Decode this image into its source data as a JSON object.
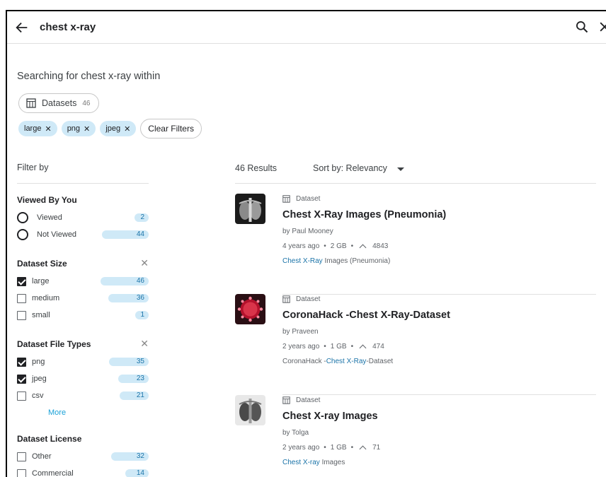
{
  "search": {
    "query": "chest x-ray"
  },
  "scope": {
    "prefix": "Searching for chest x-ray within"
  },
  "datasets_chip": {
    "label": "Datasets",
    "count": "46"
  },
  "active_filters": [
    "large",
    "png",
    "jpeg"
  ],
  "clear_filters_label": "Clear Filters",
  "sidebar": {
    "filter_by_label": "Filter by",
    "viewed": {
      "title": "Viewed By You",
      "items": [
        {
          "label": "Viewed",
          "count": "2",
          "fill": 0.045
        },
        {
          "label": "Not Viewed",
          "count": "44",
          "fill": 0.96
        }
      ]
    },
    "size": {
      "title": "Dataset Size",
      "items": [
        {
          "label": "large",
          "count": "46",
          "checked": true,
          "fill": 1.0
        },
        {
          "label": "medium",
          "count": "36",
          "checked": false,
          "fill": 0.78
        },
        {
          "label": "small",
          "count": "1",
          "checked": false,
          "fill": 0.02
        }
      ]
    },
    "file_types": {
      "title": "Dataset File Types",
      "items": [
        {
          "label": "png",
          "count": "35",
          "checked": true,
          "fill": 0.76
        },
        {
          "label": "jpeg",
          "count": "23",
          "checked": true,
          "fill": 0.5
        },
        {
          "label": "csv",
          "count": "21",
          "checked": false,
          "fill": 0.46
        }
      ],
      "more_label": "More"
    },
    "license": {
      "title": "Dataset License",
      "items": [
        {
          "label": "Other",
          "count": "32",
          "checked": false,
          "fill": 0.7
        },
        {
          "label": "Commercial",
          "count": "14",
          "checked": false,
          "fill": 0.3
        }
      ]
    }
  },
  "results": {
    "count_label": "46 Results",
    "sort_label": "Sort by: Relevancy",
    "items": [
      {
        "type": "Dataset",
        "title": "Chest X-Ray Images (Pneumonia)",
        "by": "by Paul Mooney",
        "age": "4 years ago",
        "size": "2 GB",
        "votes": "4843",
        "tag_highlight": "Chest X-Ray",
        "tag_rest": " Images (Pneumonia)",
        "tag_before": ""
      },
      {
        "type": "Dataset",
        "title": "CoronaHack -Chest X-Ray-Dataset",
        "by": "by Praveen",
        "age": "2 years ago",
        "size": "1 GB",
        "votes": "474",
        "tag_before": "CoronaHack -",
        "tag_highlight": "Chest X-Ray",
        "tag_rest": "-Dataset"
      },
      {
        "type": "Dataset",
        "title": "Chest X-ray Images",
        "by": "by Tolga",
        "age": "2 years ago",
        "size": "1 GB",
        "votes": "71",
        "tag_before": "",
        "tag_highlight": "Chest X-ray",
        "tag_rest": " Images"
      }
    ]
  }
}
